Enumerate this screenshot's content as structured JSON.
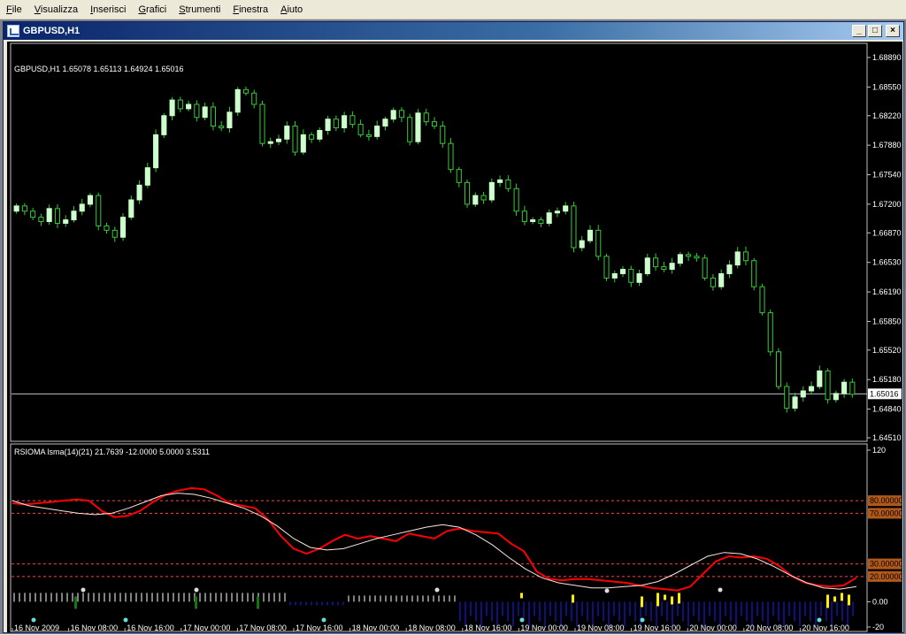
{
  "menu": [
    {
      "label": "File",
      "accel": "F",
      "rest": "ile"
    },
    {
      "label": "Visualizza",
      "accel": "V",
      "rest": "isualizza"
    },
    {
      "label": "Inserisci",
      "accel": "I",
      "rest": "nserisci"
    },
    {
      "label": "Grafici",
      "accel": "G",
      "rest": "rafici"
    },
    {
      "label": "Strumenti",
      "accel": "S",
      "rest": "trumenti"
    },
    {
      "label": "Finestra",
      "accel": "F",
      "rest": "inestra"
    },
    {
      "label": "Aiuto",
      "accel": "A",
      "rest": "iuto"
    }
  ],
  "window": {
    "title": "GBPUSD,H1",
    "min_glyph": "_",
    "max_glyph": "□",
    "close_glyph": "×"
  },
  "price_panel": {
    "info": "GBPUSD,H1  1.65078 1.65113 1.64924 1.65016",
    "current_price": 1.65016,
    "current_price_label": "1.65016",
    "y_range": [
      1.6451,
      1.6889
    ],
    "y_ticks": [
      "1.68890",
      "1.68550",
      "1.68220",
      "1.67880",
      "1.67540",
      "1.67200",
      "1.66870",
      "1.66530",
      "1.66190",
      "1.65850",
      "1.65520",
      "1.65180",
      "1.64840",
      "1.64510"
    ]
  },
  "indicator_panel": {
    "info": "RSIOMA lsma(14)(21) 21.7639 -12.0000 5.0000 3.5311",
    "y_range": [
      -20,
      120
    ],
    "y_ticks": [
      {
        "value": 120,
        "label": "120"
      },
      {
        "value": 0,
        "label": "0.00"
      },
      {
        "value": -20,
        "label": "-20"
      }
    ],
    "levels": [
      {
        "value": 80,
        "label": "80.00000"
      },
      {
        "value": 70,
        "label": "70.00000"
      },
      {
        "value": 30,
        "label": "30.00000"
      },
      {
        "value": 20,
        "label": "20.00000"
      }
    ]
  },
  "time_axis": [
    "16 Nov 2009",
    "16 Nov 08:00",
    "16 Nov 16:00",
    "17 Nov 00:00",
    "17 Nov 08:00",
    "17 Nov 16:00",
    "18 Nov 00:00",
    "18 Nov 08:00",
    "18 Nov 16:00",
    "19 Nov 00:00",
    "19 Nov 08:00",
    "19 Nov 16:00",
    "20 Nov 00:00",
    "20 Nov 08:00",
    "20 Nov 16:00"
  ],
  "colors": {
    "background": "#000000",
    "bull_candle": "#ccffcc",
    "wick": "#33cc33",
    "rsi_line": "#ff0000",
    "signal_line": "#ffe4e1",
    "level_line": "#ff4040",
    "level_label_bg": "#b2591a",
    "price_label_bg": "#ffffff"
  },
  "chart_data": [
    {
      "type": "candlestick",
      "symbol": "GBPUSD",
      "timeframe": "H1",
      "closes": [
        1.6718,
        1.6712,
        1.6705,
        1.67,
        1.6715,
        1.6698,
        1.6702,
        1.6712,
        1.672,
        1.673,
        1.6695,
        1.669,
        1.6682,
        1.6705,
        1.6725,
        1.6742,
        1.6762,
        1.68,
        1.6822,
        1.684,
        1.683,
        1.6835,
        1.682,
        1.6832,
        1.681,
        1.6808,
        1.6826,
        1.6852,
        1.6848,
        1.6835,
        1.679,
        1.6792,
        1.6795,
        1.681,
        1.678,
        1.68,
        1.6795,
        1.6805,
        1.6818,
        1.6808,
        1.6822,
        1.6812,
        1.68,
        1.6798,
        1.681,
        1.6818,
        1.6828,
        1.682,
        1.6792,
        1.6825,
        1.6815,
        1.681,
        1.679,
        1.676,
        1.6745,
        1.672,
        1.673,
        1.6725,
        1.6745,
        1.6748,
        1.6738,
        1.6712,
        1.67,
        1.6702,
        1.6698,
        1.671,
        1.6712,
        1.6718,
        1.667,
        1.6678,
        1.669,
        1.666,
        1.6635,
        1.664,
        1.6645,
        1.663,
        1.664,
        1.6658,
        1.6648,
        1.6645,
        1.6652,
        1.6662,
        1.666,
        1.6658,
        1.6635,
        1.6625,
        1.664,
        1.665,
        1.6665,
        1.6655,
        1.6625,
        1.6595,
        1.655,
        1.651,
        1.6485,
        1.6498,
        1.6505,
        1.651,
        1.6528,
        1.6495,
        1.6502,
        1.6515,
        1.6501
      ],
      "y_range": [
        1.6451,
        1.6889
      ]
    },
    {
      "type": "line",
      "title": "RSIOMA lsma(14)(21)",
      "ylim": [
        -20,
        120
      ],
      "series": [
        {
          "name": "RSIOMA",
          "values": [
            78,
            77,
            78,
            79,
            80,
            81,
            80,
            72,
            67,
            68,
            72,
            79,
            85,
            88,
            90,
            89,
            84,
            78,
            76,
            74,
            65,
            52,
            42,
            38,
            42,
            48,
            53,
            50,
            52,
            50,
            48,
            54,
            52,
            50,
            56,
            58,
            56,
            55,
            54,
            46,
            40,
            24,
            18,
            17,
            18,
            18,
            17,
            16,
            15,
            13,
            11,
            10,
            9,
            12,
            22,
            32,
            36,
            35,
            36,
            34,
            28,
            20,
            15,
            13,
            12,
            13,
            19
          ]
        },
        {
          "name": "Signal",
          "values": [
            80,
            76,
            74,
            72,
            70,
            69,
            70,
            74,
            79,
            84,
            86,
            85,
            82,
            78,
            74,
            68,
            60,
            50,
            43,
            41,
            42,
            46,
            50,
            53,
            56,
            59,
            61,
            59,
            53,
            45,
            35,
            26,
            19,
            15,
            13,
            11,
            11,
            12,
            13,
            16,
            22,
            29,
            36,
            39,
            38,
            34,
            28,
            21,
            15,
            11,
            10,
            12
          ]
        }
      ]
    }
  ]
}
